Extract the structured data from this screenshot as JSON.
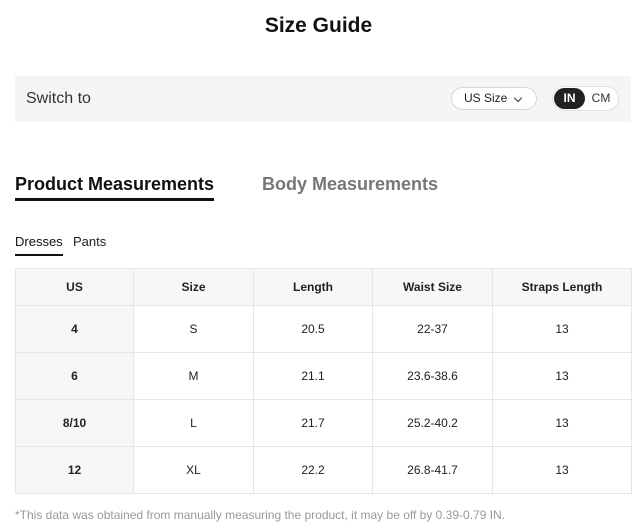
{
  "title": "Size Guide",
  "switch_bar": {
    "label": "Switch to",
    "size_system": "US Size",
    "units": {
      "active": "IN",
      "inactive": "CM"
    }
  },
  "main_tabs": {
    "active": "Product Measurements",
    "inactive": "Body Measurements"
  },
  "sub_tabs": {
    "active": "Dresses",
    "inactive": "Pants"
  },
  "table": {
    "headers": [
      "US",
      "Size",
      "Length",
      "Waist Size",
      "Straps Length"
    ],
    "rows": [
      [
        "4",
        "S",
        "20.5",
        "22-37",
        "13"
      ],
      [
        "6",
        "M",
        "21.1",
        "23.6-38.6",
        "13"
      ],
      [
        "8/10",
        "L",
        "21.7",
        "25.2-40.2",
        "13"
      ],
      [
        "12",
        "XL",
        "22.2",
        "26.8-41.7",
        "13"
      ]
    ]
  },
  "footnote": "*This data was obtained from manually measuring the product, it may be off by 0.39-0.79 IN.",
  "colors": {
    "accent": "#222222",
    "bar_background": "#f5f5f5",
    "inactive_tab": "#777777",
    "footnote": "#999999"
  }
}
